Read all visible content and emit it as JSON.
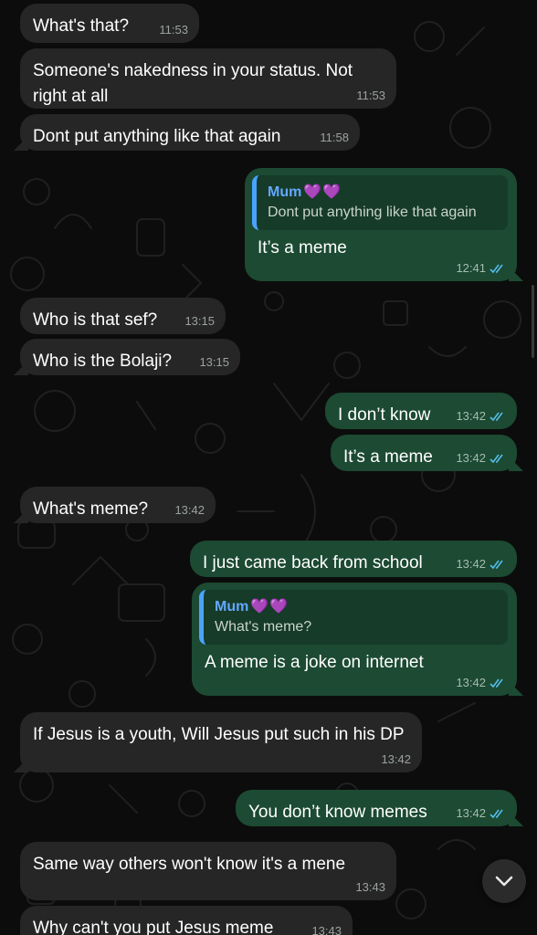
{
  "theme": {
    "incoming_bubble": "#262626",
    "outgoing_bubble": "#1c4a32",
    "quote_accent": "#4aa3ff",
    "read_ticks": "#53bdeb"
  },
  "messages": [
    {
      "text": "What's that?",
      "time": "11:53"
    },
    {
      "text": "Someone's nakedness in your status. Not right at all",
      "time": "11:53"
    },
    {
      "text": "Dont put anything like that again",
      "time": "11:58"
    },
    {
      "quote_author": "Mum",
      "quote_emoji": "💜💜",
      "quote_text": "Dont put anything like that again",
      "text": "It’s a meme",
      "time": "12:41"
    },
    {
      "text": "Who is that sef?",
      "time": "13:15"
    },
    {
      "text": "Who is the Bolaji?",
      "time": "13:15"
    },
    {
      "text": "I don’t know",
      "time": "13:42"
    },
    {
      "text": "It’s a meme",
      "time": "13:42"
    },
    {
      "text": "What's meme?",
      "time": "13:42"
    },
    {
      "text": "I just came back from school",
      "time": "13:42"
    },
    {
      "quote_author": "Mum",
      "quote_emoji": "💜💜",
      "quote_text": "What's meme?",
      "text": "A meme is a joke on internet",
      "time": "13:42"
    },
    {
      "text": "If Jesus is a youth, Will Jesus put such in his DP",
      "time": "13:42"
    },
    {
      "text": "You don’t know memes",
      "time": "13:42"
    },
    {
      "text": "Same way others won't know it's a mene",
      "time": "13:43"
    },
    {
      "text": "Why can't you put Jesus meme",
      "time": "13:43"
    }
  ],
  "controls": {
    "scroll_down_icon": "chevron-down-icon"
  }
}
